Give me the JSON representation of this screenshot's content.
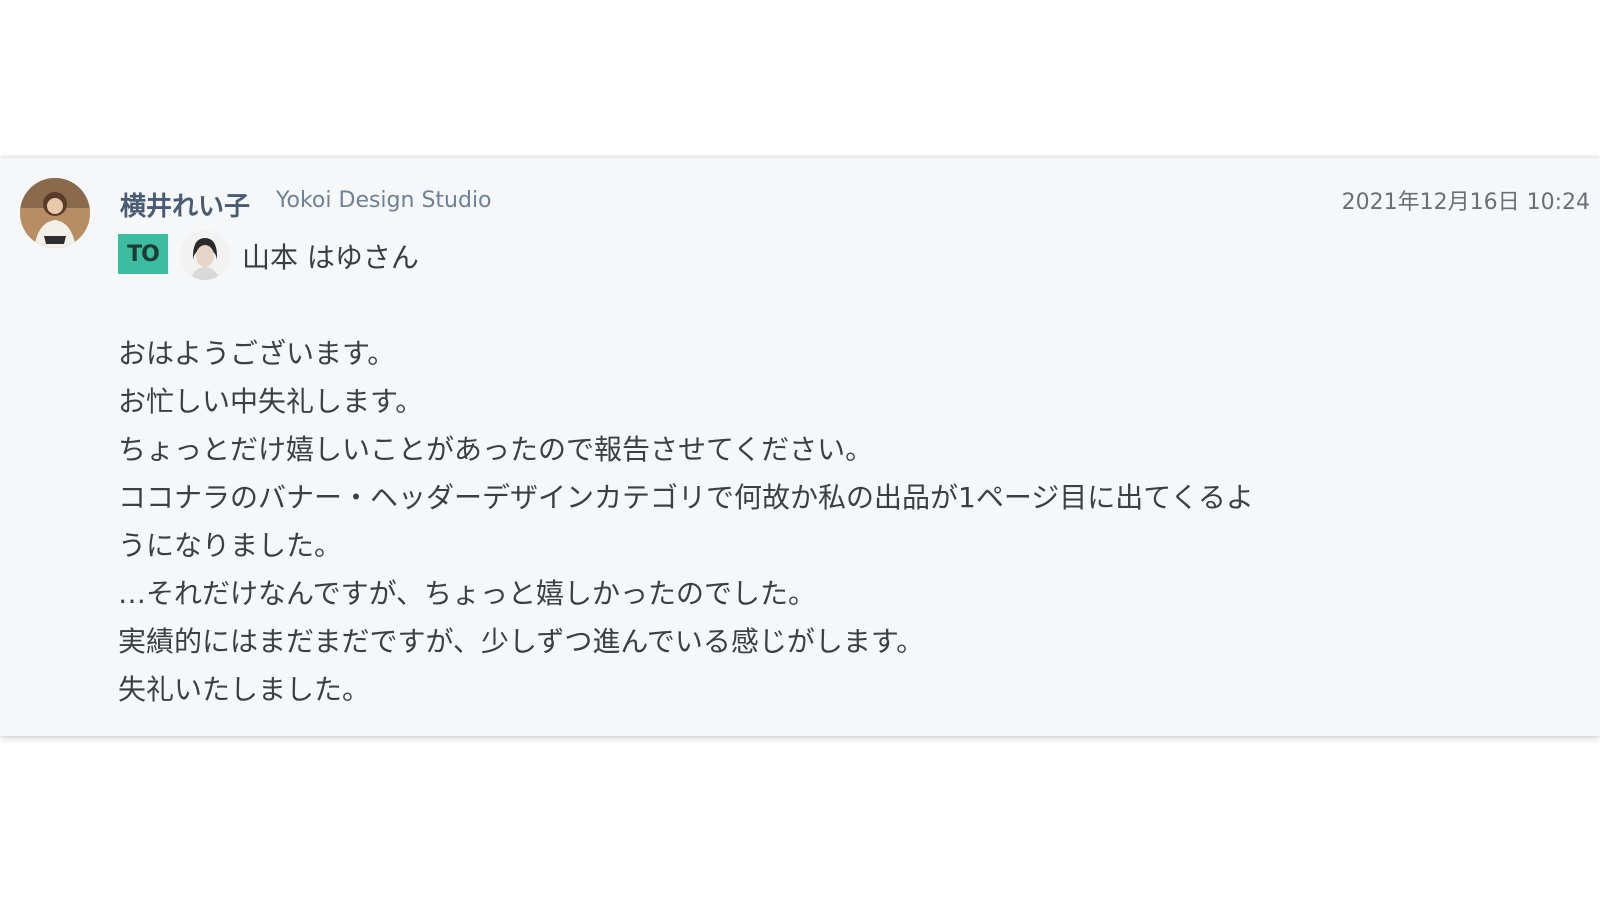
{
  "message": {
    "sender": {
      "name": "横井れい子",
      "organization": "Yokoi Design Studio",
      "avatar_icon": "user-avatar-photo"
    },
    "timestamp": "2021年12月16日 10:24",
    "to_badge": "TO",
    "recipient": {
      "name": "山本 はゆさん",
      "avatar_icon": "user-avatar-photo"
    },
    "body_lines": [
      "おはようございます。",
      "お忙しい中失礼します。",
      "ちょっとだけ嬉しいことがあったので報告させてください。",
      "ココナラのバナー・ヘッダーデザインカテゴリで何故か私の出品が1ページ目に出てくるよ",
      "うになりました。",
      "…それだけなんですが、ちょっと嬉しかったのでした。",
      "実績的にはまだまだですが、少しずつ進んでいる感じがします。",
      "失礼いたしました。"
    ]
  },
  "colors": {
    "card_background": "#f6f7f9",
    "to_badge": "#3dbd9f",
    "sender_name": "#4a5c72"
  }
}
